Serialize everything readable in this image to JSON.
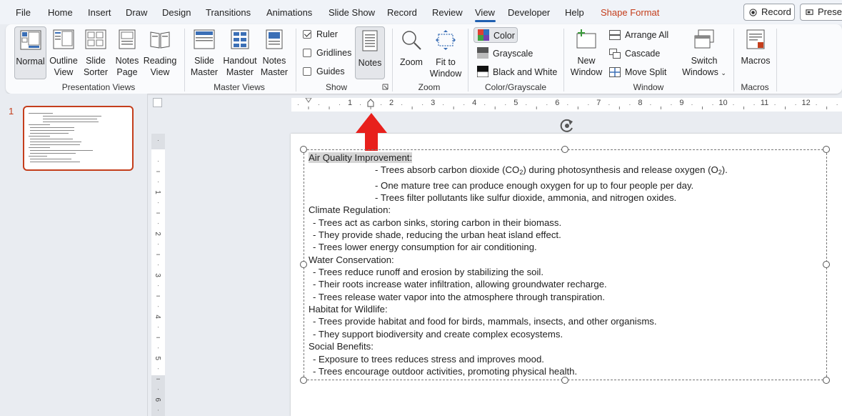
{
  "menu": {
    "items": [
      "File",
      "Home",
      "Insert",
      "Draw",
      "Design",
      "Transitions",
      "Animations",
      "Slide Show",
      "Record",
      "Review",
      "View",
      "Developer",
      "Help",
      "Shape Format"
    ],
    "active": "View",
    "record_button": "Record",
    "present_button": "Presen"
  },
  "ribbon": {
    "presentation_views": {
      "label": "Presentation Views",
      "normal": "Normal",
      "outline_view_1": "Outline",
      "outline_view_2": "View",
      "slide_sorter_1": "Slide",
      "slide_sorter_2": "Sorter",
      "notes_page_1": "Notes",
      "notes_page_2": "Page",
      "reading_view_1": "Reading",
      "reading_view_2": "View"
    },
    "master_views": {
      "label": "Master Views",
      "slide_master_1": "Slide",
      "slide_master_2": "Master",
      "handout_master_1": "Handout",
      "handout_master_2": "Master",
      "notes_master_1": "Notes",
      "notes_master_2": "Master"
    },
    "show": {
      "label": "Show",
      "ruler": "Ruler",
      "ruler_checked": true,
      "gridlines": "Gridlines",
      "gridlines_checked": false,
      "guides": "Guides",
      "guides_checked": false,
      "notes": "Notes"
    },
    "zoom": {
      "label": "Zoom",
      "zoom": "Zoom",
      "fit_1": "Fit to",
      "fit_2": "Window"
    },
    "color": {
      "label": "Color/Grayscale",
      "color": "Color",
      "grayscale": "Grayscale",
      "bw": "Black and White"
    },
    "window": {
      "label": "Window",
      "new_1": "New",
      "new_2": "Window",
      "arrange_all": "Arrange All",
      "cascade": "Cascade",
      "move_split": "Move Split",
      "switch_1": "Switch",
      "switch_2": "Windows"
    },
    "macros": {
      "label": "Macros",
      "macros": "Macros"
    }
  },
  "thumbnail": {
    "number": "1"
  },
  "ruler": {
    "h_numbers": [
      "1",
      "2",
      "3",
      "4",
      "5",
      "6",
      "7",
      "8",
      "9",
      "10",
      "11",
      "12"
    ],
    "v_numbers": [
      "1",
      "2",
      "3",
      "4",
      "5",
      "6"
    ]
  },
  "slide": {
    "title": "Air Quality Improvement:",
    "aq_bullets": [
      "- Trees absorb carbon dioxide (CO",
      "2",
      ") during photosynthesis and release oxygen (O",
      "2",
      ").",
      "- One mature tree can produce enough oxygen for up to four people per day.",
      "- Trees filter pollutants like sulfur dioxide, ammonia, and nitrogen oxides."
    ],
    "climate": {
      "heading": "Climate Regulation:",
      "bullets": [
        "- Trees act as carbon sinks, storing carbon in their biomass.",
        "- They provide shade, reducing the urban heat island effect.",
        "- Trees lower energy consumption for air conditioning."
      ]
    },
    "water": {
      "heading": "Water Conservation:",
      "bullets": [
        "- Trees reduce runoff and erosion by stabilizing the soil.",
        "- Their roots increase water infiltration, allowing groundwater recharge.",
        "- Trees release water vapor into the atmosphere through transpiration."
      ]
    },
    "habitat": {
      "heading": "Habitat for Wildlife:",
      "bullets": [
        "- Trees provide habitat and food for birds, mammals, insects, and other organisms.",
        "- They support biodiversity and create complex ecosystems."
      ]
    },
    "social": {
      "heading": "Social Benefits:",
      "bullets": [
        "- Exposure to trees reduces stress and improves mood.",
        "- Trees encourage outdoor activities, promoting physical health."
      ]
    }
  },
  "colors": {
    "accent": "#c43e1c",
    "arrow": "#e8201c",
    "view_underline": "#1f5fb0"
  }
}
